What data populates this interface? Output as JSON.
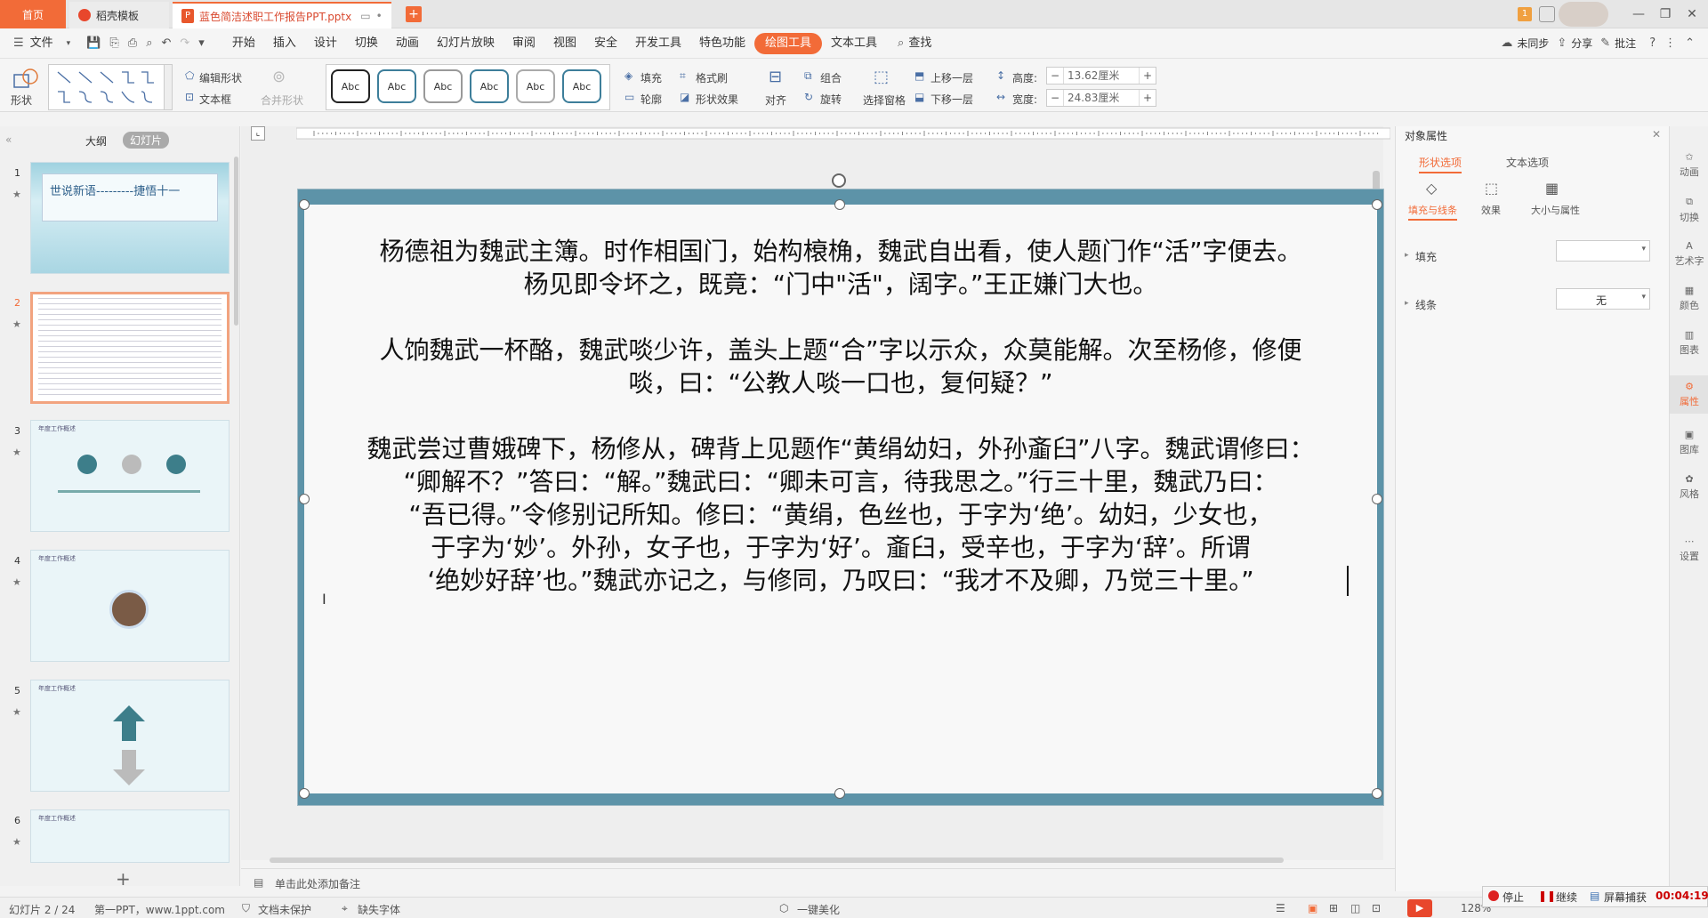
{
  "tabs": {
    "home": "首页",
    "template": "稻壳模板",
    "document": "蓝色简洁述职工作报告PPT.pptx"
  },
  "menu": {
    "file": "文件",
    "items": [
      "开始",
      "插入",
      "设计",
      "切换",
      "动画",
      "幻灯片放映",
      "审阅",
      "视图",
      "安全",
      "开发工具",
      "特色功能",
      "绘图工具",
      "文本工具"
    ],
    "active_index": 11,
    "search": "查找",
    "sync": "未同步",
    "share": "分享",
    "comment": "批注"
  },
  "ribbon": {
    "shape": "形状",
    "edit_shape": "编辑形状",
    "textbox": "文本框",
    "merge_shape": "合并形状",
    "style_label": "Abc",
    "fill": "填充",
    "format_brush": "格式刷",
    "outline": "轮廓",
    "shape_effect": "形状效果",
    "align": "对齐",
    "group": "组合",
    "rotate": "旋转",
    "selection_pane": "选择窗格",
    "bring_forward": "上移一层",
    "send_backward": "下移一层",
    "height_label": "高度:",
    "height_value": "13.62厘米",
    "width_label": "宽度:",
    "width_value": "24.83厘米"
  },
  "left_panel": {
    "tab_outline": "大纲",
    "tab_slides": "幻灯片",
    "slide1_title": "世说新语---------捷悟十一",
    "slide_header": "年度工作概述"
  },
  "slide": {
    "para1": [
      "杨德祖为魏武主簿。时作相国门，始构榱桷，魏武自出看，使人题门作“活”字便去。",
      "杨见即令坏之，既竟：“门中\"活\"，阔字。”王正嫌门大也。"
    ],
    "para2": [
      "人饷魏武一杯酪，魏武啖少许，盖头上题“合”字以示众，众莫能解。次至杨修，修便",
      "啖，曰：“公教人啖一口也，复何疑？”"
    ],
    "para3": [
      "魏武尝过曹娥碑下，杨修从，碑背上见题作“黄绢幼妇，外孙齑臼”八字。魏武谓修曰：",
      "“卿解不？”答曰：“解。”魏武曰：“卿未可言，待我思之。”行三十里，魏武乃曰：",
      "“吾已得。”令修别记所知。修曰：“黄绢，色丝也，于字为‘绝’。幼妇，少女也，",
      "于字为‘妙’。外孙，女子也，于字为‘好’。齑臼，受辛也，于字为‘辞’。所谓",
      "‘绝妙好辞’也。”魏武亦记之，与修同，乃叹曰：“我才不及卿，乃觉三十里。”"
    ]
  },
  "notes_placeholder": "单击此处添加备注",
  "right_pane": {
    "title": "对象属性",
    "tab_shape": "形状选项",
    "tab_text": "文本选项",
    "sub_fill_line": "填充与线条",
    "sub_effect": "效果",
    "sub_size": "大小与属性",
    "fill_label": "填充",
    "line_label": "线条",
    "line_value": "无"
  },
  "sidebar": [
    "动画",
    "切换",
    "艺术字",
    "颜色",
    "图表",
    "属性",
    "图库",
    "风格",
    "设置"
  ],
  "status": {
    "slide_index": "幻灯片 2 / 24",
    "theme": "第一PPT，www.1ppt.com",
    "protect": "文档未保护",
    "missing_font": "缺失字体",
    "beautify": "一键美化",
    "zoom": "128%",
    "rec_stop": "停止",
    "rec_continue": "继续",
    "rec_capture": "屏幕捕获",
    "rec_time": "00:04:19"
  }
}
